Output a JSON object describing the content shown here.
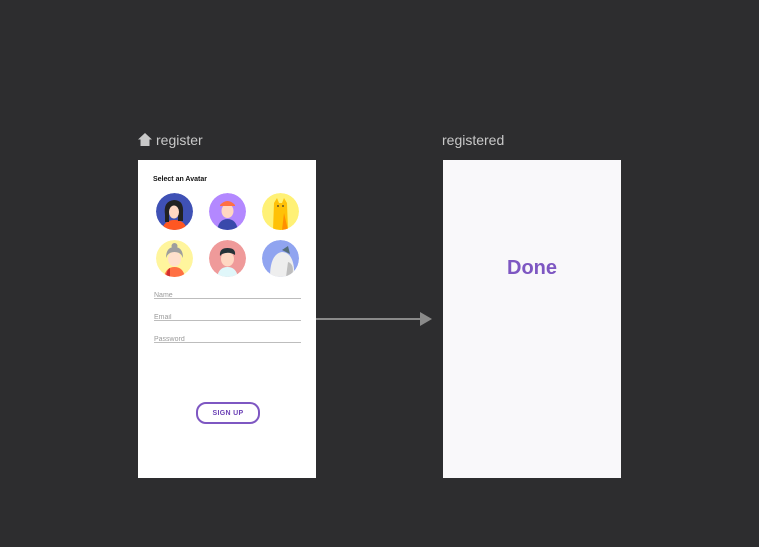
{
  "destinations": {
    "register": {
      "label": "register",
      "start_icon": "home-icon"
    },
    "registered": {
      "label": "registered"
    }
  },
  "register_screen": {
    "avatar_title": "Select an Avatar",
    "avatars": [
      {
        "name": "avatar-girl-dark-hair",
        "bg": "#3f51b5"
      },
      {
        "name": "avatar-boy-orange-cap",
        "bg": "#b388ff"
      },
      {
        "name": "avatar-yellow-cat",
        "bg": "#fff176"
      },
      {
        "name": "avatar-grandma",
        "bg": "#fff59d"
      },
      {
        "name": "avatar-boy-dark-hair",
        "bg": "#ef9a9a"
      },
      {
        "name": "avatar-white-dog",
        "bg": "#90a4f0"
      }
    ],
    "fields": {
      "name_placeholder": "Name",
      "email_placeholder": "Email",
      "password_placeholder": "Password"
    },
    "signup_label": "SIGN UP"
  },
  "registered_screen": {
    "done_label": "Done"
  },
  "colors": {
    "background": "#2d2d2f",
    "accent": "#7e57c2",
    "arrow": "#8a8a8a"
  }
}
